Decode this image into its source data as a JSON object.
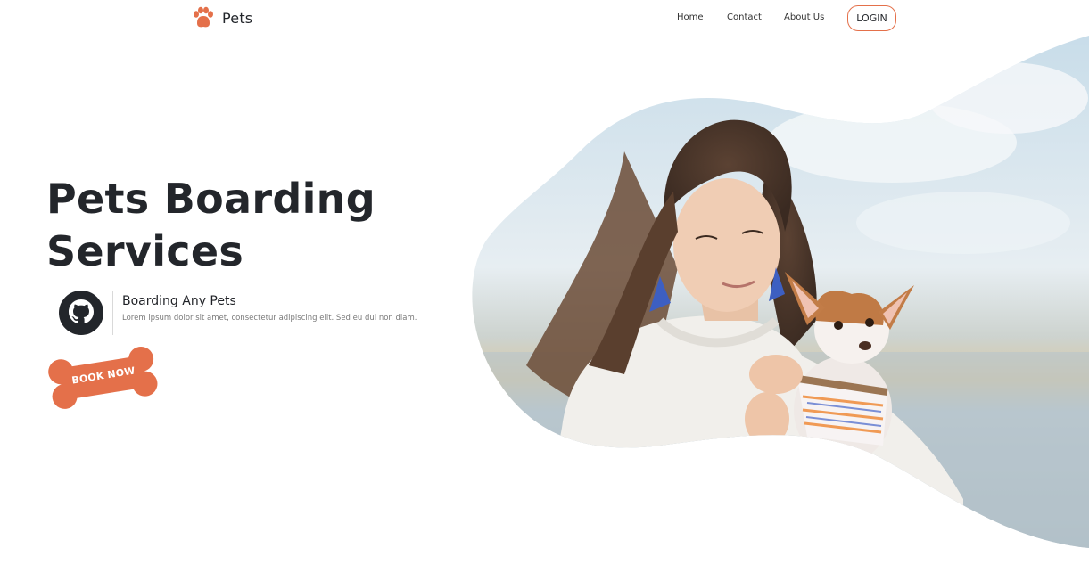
{
  "brand": {
    "name": "Pets",
    "icon": "paw-icon",
    "accent": "#e4704a"
  },
  "nav": {
    "links": [
      "Home",
      "Contact",
      "About Us"
    ],
    "login_label": "LOGIN"
  },
  "hero": {
    "title_line1": "Pets Boarding",
    "title_line2": "Services",
    "feature": {
      "icon": "github-icon",
      "title": "Boarding Any Pets",
      "description": "Lorem ipsum dolor sit amet, consectetur adipiscing elit. Sed eu dui non diam."
    },
    "cta_label": "BOOK NOW"
  },
  "colors": {
    "accent": "#e4704a",
    "text_dark": "#23262b"
  }
}
